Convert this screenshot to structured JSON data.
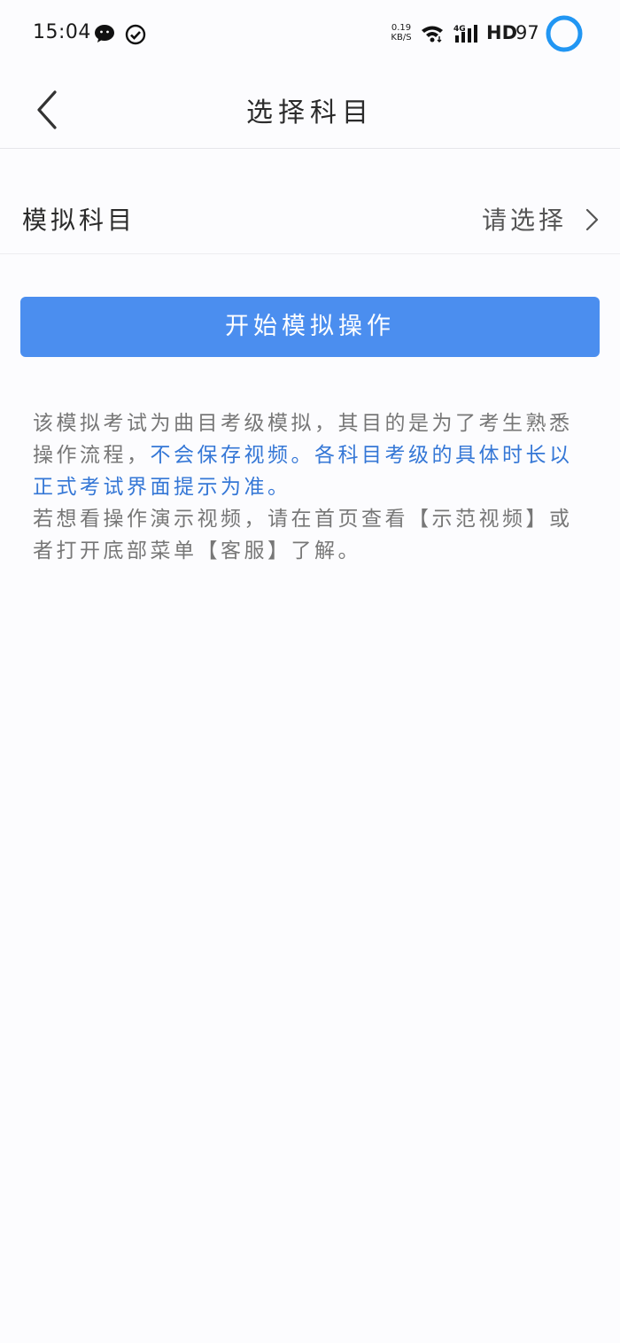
{
  "status_bar": {
    "time": "15:04",
    "net_speed_value": "0.19",
    "net_speed_unit": "KB/S",
    "hd": "HD",
    "battery": "97",
    "icons": [
      "wechat-icon",
      "check-circle-icon",
      "wifi-icon",
      "signal-4g-icon",
      "battery-ring-icon"
    ]
  },
  "header": {
    "title": "选择科目",
    "back_icon": "chevron-left-icon"
  },
  "subject_row": {
    "label": "模拟科目",
    "value": "请选择",
    "chevron_icon": "chevron-right-icon"
  },
  "start_button": {
    "label": "开始模拟操作"
  },
  "notice": {
    "line1_gray": "该模拟考试为曲目考级模拟，其目的是为了考生熟悉操作流程，",
    "line1_blue": "不会保存视频。各科目考级的具体时长以正式考试界面提示为准。",
    "line2_gray": "若想看操作演示视频，请在首页查看【示范视频】或者打开底部菜单【客服】了解。"
  },
  "colors": {
    "accent": "#4b8eef",
    "highlight_text": "#3577d6",
    "battery_ring": "#2196f3"
  }
}
